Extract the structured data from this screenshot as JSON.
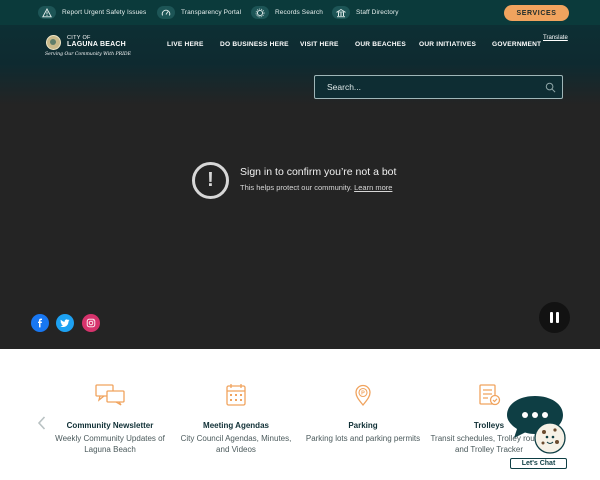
{
  "utility_bar": {
    "links": [
      {
        "label": "Report Urgent Safety Issues",
        "icon": "warning-icon"
      },
      {
        "label": "Transparency Portal",
        "icon": "gauge-icon"
      },
      {
        "label": "Records Search",
        "icon": "gear-search-icon"
      },
      {
        "label": "Staff Directory",
        "icon": "building-icon"
      }
    ],
    "services_label": "SERVICES"
  },
  "header": {
    "logo_city": "CITY OF",
    "logo_name": "LAGUNA BEACH",
    "logo_tagline": "Serving Our Community With PRIDE",
    "nav": [
      "LIVE HERE",
      "DO BUSINESS HERE",
      "VISIT HERE",
      "OUR BEACHES",
      "OUR INITIATIVES",
      "GOVERNMENT"
    ],
    "translate_label": "Translate"
  },
  "search": {
    "placeholder": "Search..."
  },
  "video_notice": {
    "title": "Sign in to confirm you’re not a bot",
    "subtitle": "This helps protect our community.",
    "link": "Learn more"
  },
  "social": [
    {
      "name": "facebook-icon",
      "color": "#1877f2"
    },
    {
      "name": "twitter-icon",
      "color": "#1da1f2"
    },
    {
      "name": "instagram-icon",
      "color": "#d6336c"
    }
  ],
  "quick_links": [
    {
      "title": "Community Newsletter",
      "description": "Weekly Community Updates of Laguna Beach",
      "icon": "chat-bubbles-icon"
    },
    {
      "title": "Meeting Agendas",
      "description": "City Council Agendas, Minutes, and Videos",
      "icon": "calendar-icon"
    },
    {
      "title": "Parking",
      "description": "Parking lots and parking permits",
      "icon": "parking-pin-icon"
    },
    {
      "title": "Trolleys",
      "description": "Transit schedules, Trolley routes, and Trolley Tracker",
      "icon": "schedule-icon"
    }
  ],
  "chat": {
    "label": "Let's Chat"
  },
  "colors": {
    "topbar": "#0b3a3b",
    "accent": "#f0a35e",
    "hero": "#242424",
    "icon_orange": "#f0a35e",
    "chat_dark": "#0e3e44"
  }
}
